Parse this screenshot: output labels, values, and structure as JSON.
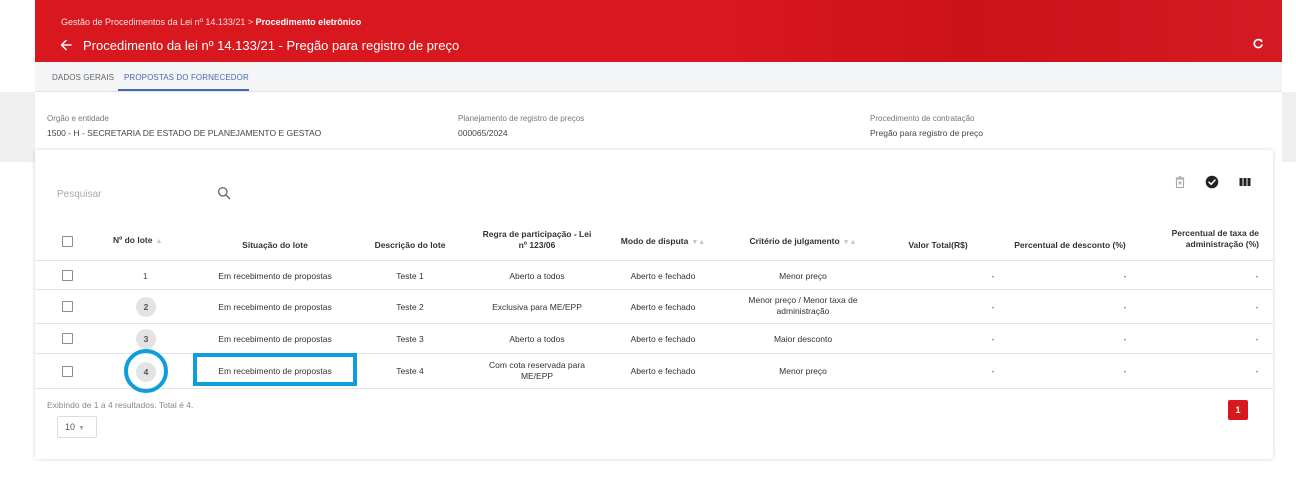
{
  "header": {
    "breadcrumb_prefix": "Gestão de Procedimentos da Lei nº 14.133/21 > ",
    "breadcrumb_current": "Procedimento eletrônico",
    "title": "Procedimento da lei nº 14.133/21 - Pregão para registro de preço"
  },
  "tabs": [
    {
      "label": "DADOS GERAIS"
    },
    {
      "label": "PROPOSTAS DO FORNECEDOR"
    }
  ],
  "info": {
    "orgao_label": "Orgão e entidade",
    "orgao_value": "1500 - H - SECRETARIA DE ESTADO DE PLANEJAMENTO E GESTAO",
    "planejamento_label": "Planejamento de registro de preços",
    "planejamento_value": "000065/2024",
    "procedimento_label": "Procedimento de contratação",
    "procedimento_value": "Pregão para registro de preço"
  },
  "search": {
    "placeholder": "Pesquisar"
  },
  "table": {
    "headers": {
      "lote": "Nº do lote",
      "situacao": "Situação do lote",
      "descricao": "Descrição do lote",
      "regra_1": "Regra de participação - Lei",
      "regra_2": "nº 123/06",
      "modo": "Modo de disputa",
      "criterio": "Critério de julgamento",
      "valor": "Valor Total(R$)",
      "desconto": "Percentual de desconto (%)",
      "taxa_1": "Percentual de taxa de",
      "taxa_2": "administração (%)"
    },
    "rows": [
      {
        "lote": "1",
        "situacao": "Em recebimento de propostas",
        "descricao": "Teste 1",
        "regra_1": "Aberto a todos",
        "regra_2": "",
        "modo": "Aberto e fechado",
        "criterio_1": "Menor preço",
        "criterio_2": "",
        "valor": "-",
        "desconto": "-",
        "taxa": "-"
      },
      {
        "lote": "2",
        "situacao": "Em recebimento de propostas",
        "descricao": "Teste 2",
        "regra_1": "Exclusiva para ME/EPP",
        "regra_2": "",
        "modo": "Aberto e fechado",
        "criterio_1": "Menor preço / Menor taxa de",
        "criterio_2": "administração",
        "valor": "-",
        "desconto": "-",
        "taxa": "-"
      },
      {
        "lote": "3",
        "situacao": "Em recebimento de propostas",
        "descricao": "Teste 3",
        "regra_1": "Aberto a todos",
        "regra_2": "",
        "modo": "Aberto e fechado",
        "criterio_1": "Maior desconto",
        "criterio_2": "",
        "valor": "-",
        "desconto": "-",
        "taxa": "-"
      },
      {
        "lote": "4",
        "situacao": "Em recebimento de propostas",
        "descricao": "Teste 4",
        "regra_1": "Com cota reservada para",
        "regra_2": "ME/EPP",
        "modo": "Aberto e fechado",
        "criterio_1": "Menor preço",
        "criterio_2": "",
        "valor": "-",
        "desconto": "-",
        "taxa": "-"
      }
    ]
  },
  "footer": {
    "results": "Exibindo de 1 a 4 resultados. Total é 4.",
    "page_size": "10",
    "page": "1"
  },
  "colors": {
    "brand_red": "#d8171e",
    "tab_active": "#4a67b4",
    "highlight": "#0f9edb"
  }
}
